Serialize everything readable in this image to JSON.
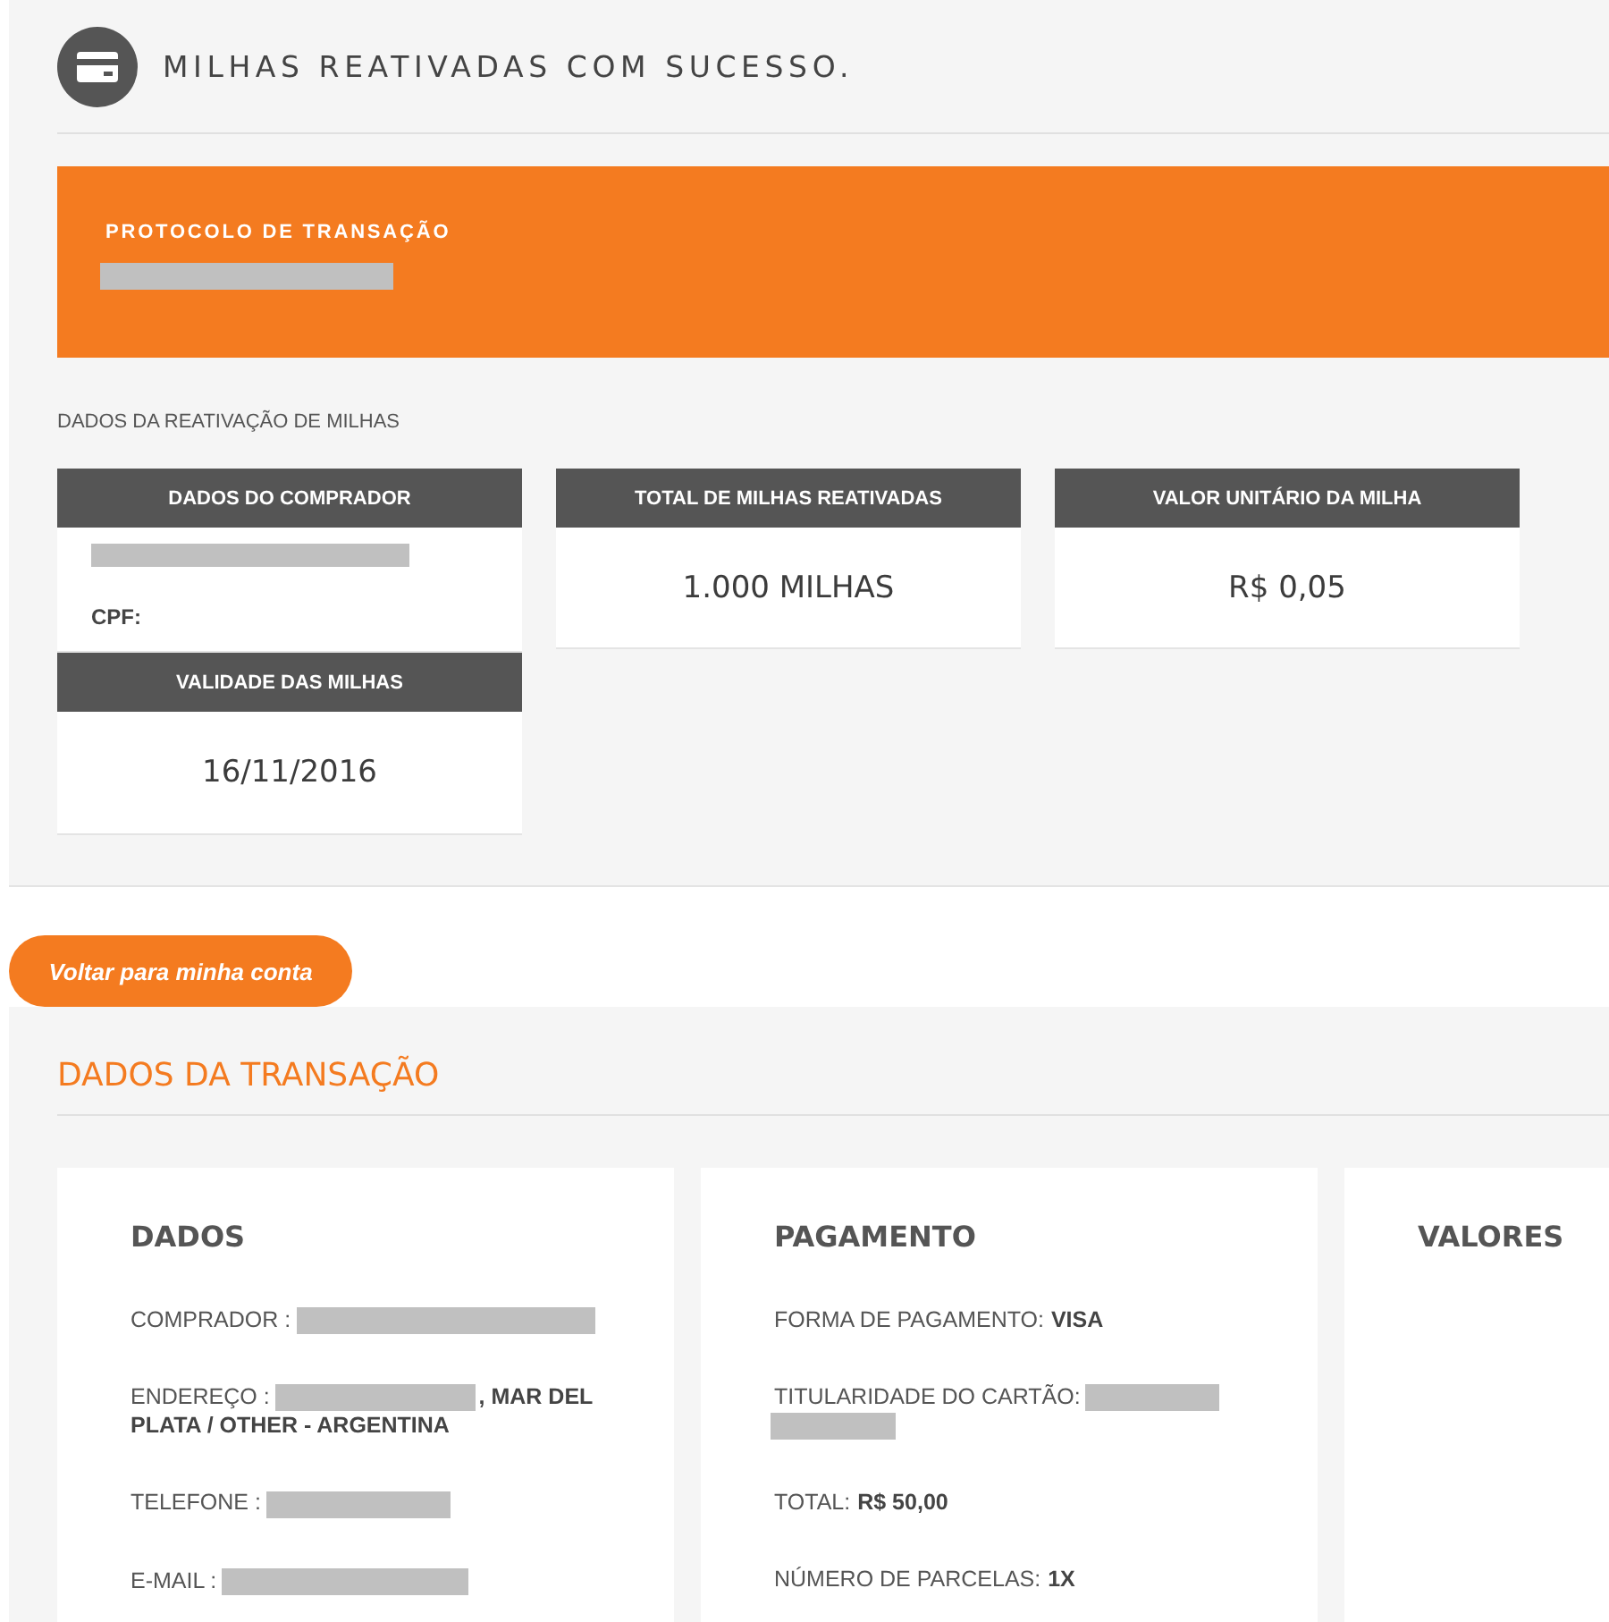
{
  "header": {
    "title": "MILHAS REATIVADAS COM SUCESSO."
  },
  "protocol": {
    "label": "PROTOCOLO DE TRANSAÇÃO",
    "value_redacted": true
  },
  "reactivation": {
    "title": "DADOS DA REATIVAÇÃO DE MILHAS",
    "buyer": {
      "header": "DADOS DO COMPRADOR",
      "name_redacted": true,
      "cpf_label": "CPF:"
    },
    "validity": {
      "header": "VALIDADE DAS MILHAS",
      "value": "16/11/2016"
    },
    "totals": [
      {
        "header": "TOTAL DE MILHAS REATIVADAS",
        "value": "1.000 MILHAS"
      },
      {
        "header": "VALOR UNITÁRIO DA MILHA",
        "value": "R$ 0,05"
      }
    ]
  },
  "back_button": {
    "label": "Voltar para minha conta"
  },
  "transaction": {
    "title": "DADOS DA TRANSAÇÃO",
    "panels": [
      {
        "title": "DADOS",
        "fields": [
          {
            "label": "COMPRADOR :",
            "redacted": true
          },
          {
            "label": "ENDEREÇO :",
            "redacted": true,
            "value": ", MAR DEL PLATA / OTHER - ARGENTINA"
          },
          {
            "label": "TELEFONE :",
            "redacted": true
          },
          {
            "label": "E-MAIL :",
            "redacted": true
          }
        ]
      },
      {
        "title": "PAGAMENTO",
        "fields": [
          {
            "label": "FORMA DE PAGAMENTO:",
            "redacted": false,
            "value": "VISA"
          },
          {
            "label": "TITULARIDADE DO CARTÃO:",
            "redacted": true
          },
          {
            "label": "TOTAL:",
            "redacted": false,
            "value": "R$ 50,00"
          },
          {
            "label": "NÚMERO DE PARCELAS:",
            "redacted": false,
            "value": "1X"
          }
        ]
      },
      {
        "title": "VALORES"
      }
    ]
  }
}
